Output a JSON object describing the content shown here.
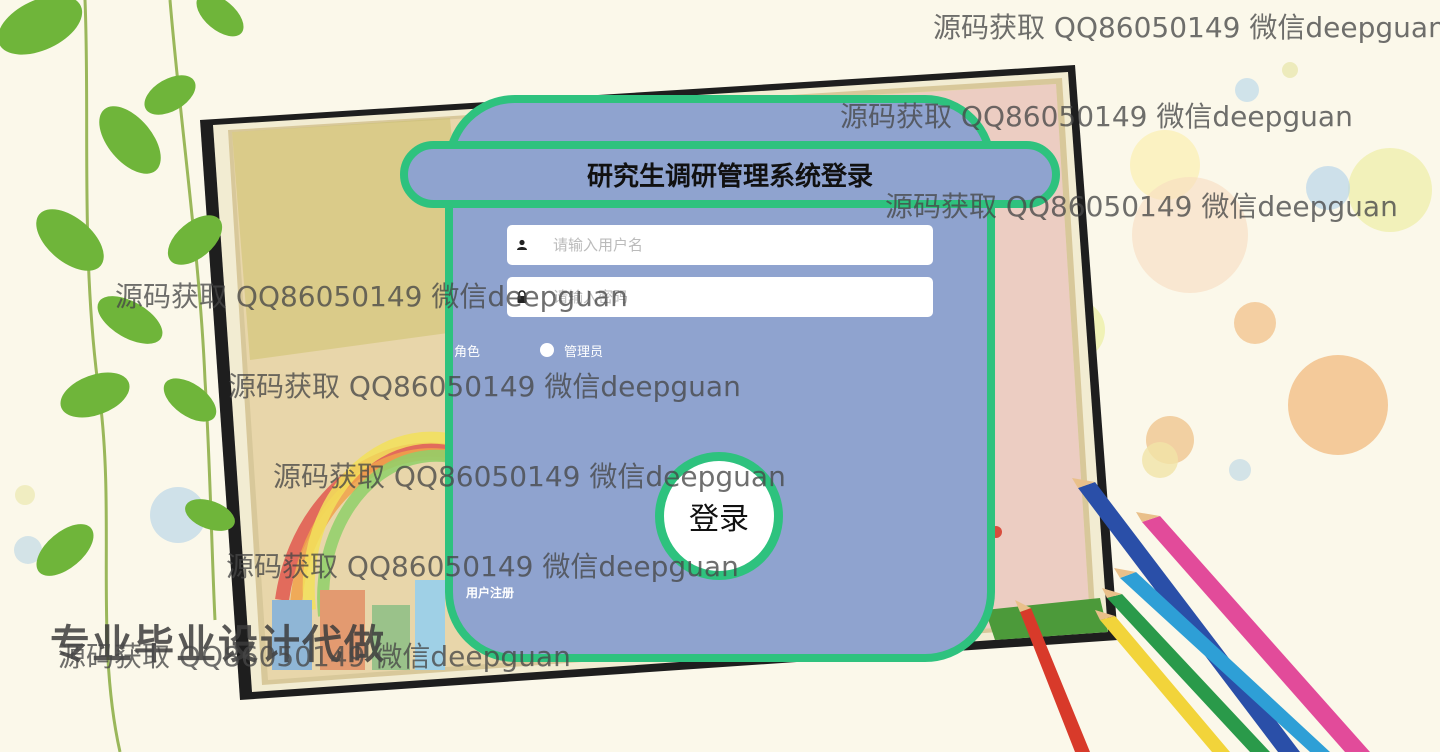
{
  "login": {
    "title": "研究生调研管理系统登录",
    "username_placeholder": "请输入用户名",
    "password_placeholder": "请输入密码",
    "role_label": "角色",
    "role_option": "管理员",
    "login_button": "登录",
    "register_link": "用户注册"
  },
  "watermarks": [
    "源码获取 QQ86050149 微信deepguan",
    "源码获取 QQ86050149 微信deepguan",
    "源码获取 QQ86050149 微信deepguan",
    "源码获取 QQ86050149 微信deepguan",
    "源码获取 QQ86050149 微信deepguan",
    "源码获取 QQ86050149 微信deepguan",
    "源码获取 QQ86050149 微信deepguan",
    "源码获取 QQ86050149 微信deepguan"
  ],
  "banner": "专业毕业设计代做",
  "colors": {
    "accent_green": "#2ec27e",
    "card_blue": "#8fa3cf"
  },
  "icons": {
    "username": "person-icon",
    "password": "lock-icon"
  }
}
